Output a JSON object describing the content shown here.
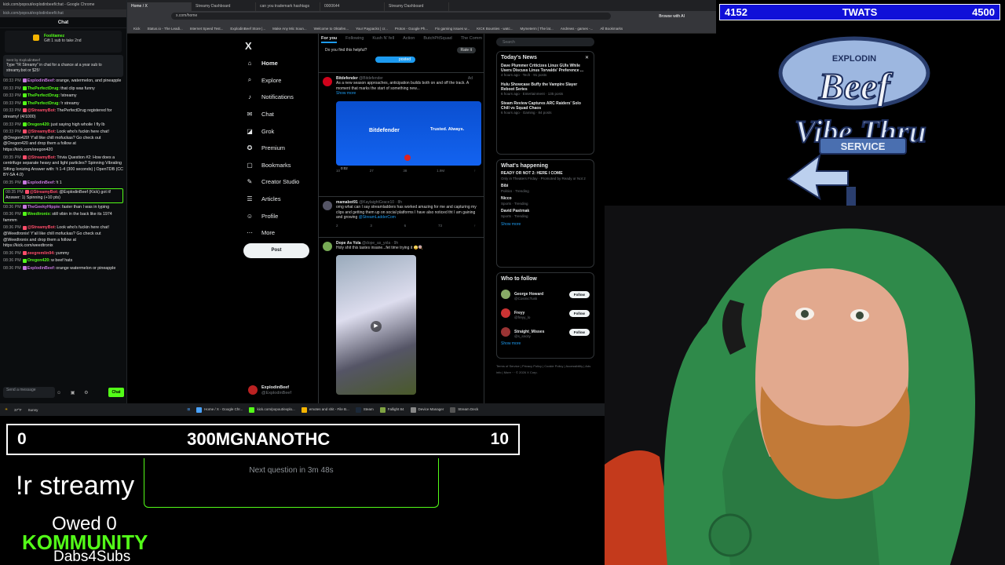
{
  "chat_window": {
    "title": "kick.com/popout/explodinbeef/chat - Google Chrome",
    "url": "kick.com/popout/explodinbeef/chat",
    "header": "Chat",
    "gift": {
      "user": "Foolitamez",
      "text": "Gift 1 sub to take 2nd"
    },
    "pinned": {
      "by": "Sent by ExplodinBeef",
      "text": "Type \"!R Streamy\" in chat for a chance at a year sub to streamy.bot or $25!"
    },
    "messages": [
      {
        "time": "08:33 PM",
        "user": "ExplodinBeef:",
        "text": "orange, watermelon, and pineapple",
        "color": "#c678dd"
      },
      {
        "time": "08:33 PM",
        "user": "ThePerfectDrug:",
        "text": "that clip was funny",
        "color": "#53fc18"
      },
      {
        "time": "08:33 PM",
        "user": "ThePerfectDrug:",
        "text": "!streamy",
        "color": "#53fc18"
      },
      {
        "time": "08:33 PM",
        "user": "ThePerfectDrug:",
        "text": "!r streamy",
        "color": "#53fc18"
      },
      {
        "time": "08:33 PM",
        "user": "@StreamyBot:",
        "text": "ThePerfectDrug registered for streamy! (4/1000)",
        "color": "#ff4d6a"
      },
      {
        "time": "08:33 PM",
        "user": "Oregon420:",
        "text": "just saying high whoile I fly lb",
        "color": "#53fc18"
      },
      {
        "time": "08:33 PM",
        "user": "@StreamyBot:",
        "text": "Look who's fuckin here chat! @Oregon420! Y'all like chill mofuckas? Go check out @Oregon420 and drop them a follow at https://kick.com/oregon420",
        "color": "#ff4d6a"
      },
      {
        "time": "08:35 PM",
        "user": "@StreamyBot:",
        "text": "Trivia Question #2: How does a centrifuge separate heavy and light particles? Spinning Vibrating Sifting Ionizing Answer with: !t 1-4 (300 seconds) | OpenTDB (CC BY-SA 4.0)",
        "color": "#ff4d6a"
      },
      {
        "time": "08:35 PM",
        "user": "ExplodinBeef:",
        "text": "!t 1",
        "color": "#c678dd"
      },
      {
        "time": "08:35 PM",
        "user": "@StreamyBot:",
        "text": "@ExplodinBeef (Kick) got it! Answer: 1) Spinning (+10 pts)",
        "color": "#ff4d6a",
        "highlight": true
      },
      {
        "time": "08:36 PM",
        "user": "TheGeekyHippie:",
        "text": "faster than I was in typing",
        "color": "#c678dd"
      },
      {
        "time": "08:36 PM",
        "user": "Weedtronix:",
        "text": "still vibin in the back like its 1974 fammm",
        "color": "#53fc18"
      },
      {
        "time": "08:36 PM",
        "user": "@StreamyBot:",
        "text": "Look who's fuckin here chat! @Weedtronix! Y'all like chill mofuckas? Go check out @Weedtronix and drop them a follow at https://kick.com/weedtronix",
        "color": "#ff4d6a"
      },
      {
        "time": "08:36 PM",
        "user": "zeegremlin94:",
        "text": "yummy",
        "color": "#ff4d6a"
      },
      {
        "time": "08:36 PM",
        "user": "Oregon420:",
        "text": "w beef hats",
        "color": "#53fc18"
      },
      {
        "time": "08:36 PM",
        "user": "ExplodinBeef:",
        "text": "orange watermelon or pineapple",
        "color": "#c678dd"
      }
    ],
    "input_placeholder": "Send a message",
    "chat_button": "Chat"
  },
  "browser": {
    "tabs": [
      "Home / X",
      "Streamy Dashboard",
      "can you trademark hashtags",
      "0000644",
      "Streamy Dashboard"
    ],
    "url": "x.com/home",
    "bookmarks": [
      "Kick",
      "Status.io - The Leadi...",
      "Internet Speed Test...",
      "ExplodinBeef Store |...",
      "Make Any Mic Soun...",
      "Welcome to Oktafen...",
      "Your Paypacks | cr...",
      "Proton - Google Ph...",
      "Fix gaming issues w...",
      "KICK Bounties - watc...",
      "Mymeterm | The lat...",
      "Andrews - games -...",
      "All Bookmarks"
    ],
    "browse_ai": "Browse with AI"
  },
  "x": {
    "logo": "X",
    "nav": [
      {
        "icon": "⌂",
        "label": "Home"
      },
      {
        "icon": "⌕",
        "label": "Explore"
      },
      {
        "icon": "♪",
        "label": "Notifications"
      },
      {
        "icon": "✉",
        "label": "Chat"
      },
      {
        "icon": "◪",
        "label": "Grok"
      },
      {
        "icon": "✪",
        "label": "Premium"
      },
      {
        "icon": "▢",
        "label": "Bookmarks"
      },
      {
        "icon": "✎",
        "label": "Creator Studio"
      },
      {
        "icon": "☰",
        "label": "Articles"
      },
      {
        "icon": "☺",
        "label": "Profile"
      },
      {
        "icon": "⋯",
        "label": "More"
      }
    ],
    "post_button": "Post",
    "profile": {
      "name": "ExplodinBeef",
      "handle": "@ExplodinBeef"
    },
    "feed_tabs": [
      "For you",
      "Following",
      "Kush N' fell",
      "Action",
      "ButchPitSquad",
      "The Comm"
    ],
    "helpful": {
      "question": "Do you find this helpful?",
      "rate": "Rate it",
      "posted": "posted"
    },
    "tweets": [
      {
        "name": "Bitdefender",
        "handle": "@Bitdefender",
        "text": "As a new season approaches, anticipation builds both on and off the track. A moment that marks the start of something new...",
        "more": "Show more",
        "ad_brand": "Bitdefender",
        "ad_trust": "Trusted. Always.",
        "ad_label": "Ad",
        "duration": "0:02",
        "stats": [
          "10",
          "27",
          "38",
          "1.9M",
          "↑"
        ]
      },
      {
        "name": "mamabot91",
        "handle": "@KaylaightGrace10 · 8h",
        "text": "omg what can I say streamladders has worked amazing for me and capturing my clips and getting them up on social platforms I have also noticed tht I am gaining and growing",
        "link": "@StreamLadderCom",
        "stats": [
          "2",
          "3",
          "6",
          "73",
          "↑"
        ]
      },
      {
        "name": "Dope As Yola",
        "handle": "@dope_as_yola · 9h",
        "text": "Holy shit this tastes insane...fet time trying it 😳🍭"
      }
    ],
    "search_placeholder": "Search",
    "news": {
      "title": "Today's News",
      "items": [
        {
          "headline": "Dave Plummer Criticizes Linux GUIs While Users Discuss Linus Torvalds' Preference ...",
          "meta": "4 hours ago · Tech · 91 posts"
        },
        {
          "headline": "Hulu Showcase Buffy the Vampire Slayer Reboot Series",
          "meta": "6 hours ago · Entertainment · 135 posts"
        },
        {
          "headline": "Steam Review Captures ARC Raiders' Solo Chill vs Squad Chaos",
          "meta": "6 hours ago · Gaming · 84 posts"
        }
      ]
    },
    "happening": {
      "title": "What's happening",
      "items": [
        {
          "topic": "READY OR NOT 2: HERE I COME",
          "meta": "Only in Theaters Friday · Promoted by Ready or Not 2"
        },
        {
          "topic": "Bibi",
          "meta": "Politics · Trending"
        },
        {
          "topic": "Nicco",
          "meta": "Sports · Trending"
        },
        {
          "topic": "David Pastrnak",
          "meta": "Sports · Trending"
        }
      ],
      "show_more": "Show more"
    },
    "who_to_follow": {
      "title": "Who to follow",
      "items": [
        {
          "name": "George Howard",
          "handle": "@CosmicTusk"
        },
        {
          "name": "Freyy",
          "handle": "@freyy_lo"
        },
        {
          "name": "Straight_Misses",
          "handle": "@s_sncity"
        }
      ],
      "button": "Follow",
      "show_more": "Show more"
    },
    "footer": "Terms of Service | Privacy Policy | Cookie Policy | Accessibility | Ads info | More ··· © 2026 X Corp."
  },
  "taskbar": {
    "weather": "37°F",
    "weather_sub": "Sunny",
    "items": [
      "Home / X - Google Chr...",
      "kick.com/popout/explo...",
      "emotes and shit - File B...",
      "Steam",
      "Fallight 84",
      "Device Manager",
      "Stream Deck"
    ]
  },
  "overlay": {
    "counter_left": "4152",
    "counter_label": "TWATS",
    "counter_right": "4500",
    "logo_top": "EXPLODIN",
    "logo_beef": "Beef",
    "logo_vibe": "Vibe Thru",
    "logo_service": "SERVICE",
    "score_left": "0",
    "score_title": "300MGNANOTHC",
    "score_right": "10",
    "command": "!r streamy",
    "next_question": "Next question in 3m 48s",
    "owed": "Owed 0",
    "kommunity": "KOMMUNITY",
    "dabs": "Dabs4Subs"
  }
}
